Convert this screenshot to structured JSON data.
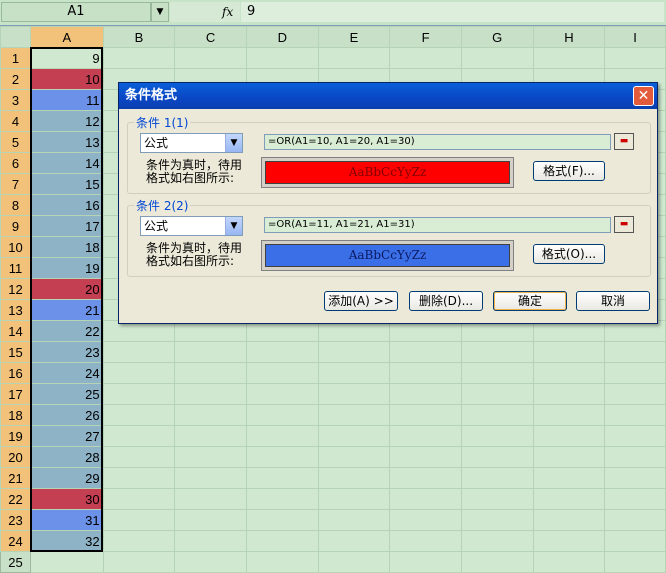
{
  "formula_bar": {
    "name_box": "A1",
    "fx_label": "fx",
    "formula": "9"
  },
  "columns": [
    "A",
    "B",
    "C",
    "D",
    "E",
    "F",
    "G",
    "H",
    "I"
  ],
  "rows": [
    {
      "num": "1",
      "value": "9",
      "style": "sel"
    },
    {
      "num": "2",
      "value": "10",
      "style": "red"
    },
    {
      "num": "3",
      "value": "11",
      "style": "blue"
    },
    {
      "num": "4",
      "value": "12",
      "style": ""
    },
    {
      "num": "5",
      "value": "13",
      "style": ""
    },
    {
      "num": "6",
      "value": "14",
      "style": ""
    },
    {
      "num": "7",
      "value": "15",
      "style": ""
    },
    {
      "num": "8",
      "value": "16",
      "style": ""
    },
    {
      "num": "9",
      "value": "17",
      "style": ""
    },
    {
      "num": "10",
      "value": "18",
      "style": ""
    },
    {
      "num": "11",
      "value": "19",
      "style": ""
    },
    {
      "num": "12",
      "value": "20",
      "style": "red"
    },
    {
      "num": "13",
      "value": "21",
      "style": "blue"
    },
    {
      "num": "14",
      "value": "22",
      "style": ""
    },
    {
      "num": "15",
      "value": "23",
      "style": ""
    },
    {
      "num": "16",
      "value": "24",
      "style": ""
    },
    {
      "num": "17",
      "value": "25",
      "style": ""
    },
    {
      "num": "18",
      "value": "26",
      "style": ""
    },
    {
      "num": "19",
      "value": "27",
      "style": ""
    },
    {
      "num": "20",
      "value": "28",
      "style": ""
    },
    {
      "num": "21",
      "value": "29",
      "style": ""
    },
    {
      "num": "22",
      "value": "30",
      "style": "red"
    },
    {
      "num": "23",
      "value": "31",
      "style": "blue"
    },
    {
      "num": "24",
      "value": "32",
      "style": ""
    },
    {
      "num": "25",
      "value": "",
      "style": "inactive"
    }
  ],
  "dialog": {
    "title": "条件格式",
    "close_glyph": "✕",
    "condition1": {
      "label": "条件 1(1)",
      "type": "公式",
      "formula": "=OR(A1=10, A1=20, A1=30)",
      "desc_line1": "条件为真时，待用",
      "desc_line2": "格式如右图所示:",
      "preview_text": "AaBbCcYyZz",
      "format_button": "格式(F)...",
      "preview_color": "#ff0000",
      "preview_text_color": "#800000"
    },
    "condition2": {
      "label": "条件 2(2)",
      "type": "公式",
      "formula": "=OR(A1=11, A1=21, A1=31)",
      "desc_line1": "条件为真时，待用",
      "desc_line2": "格式如右图所示:",
      "preview_text": "AaBbCcYyZz",
      "format_button": "格式(O)...",
      "preview_color": "#3b6fe8",
      "preview_text_color": "#0b1a60"
    },
    "buttons": {
      "add": "添加(A) >>",
      "delete": "删除(D)...",
      "ok": "确定",
      "cancel": "取消"
    }
  },
  "colors": {
    "sheet_bg": "#cfe8cf",
    "highlight_red": "#c43f52",
    "highlight_blue": "#6c91e8",
    "column_a_fill": "#8fb3c6"
  }
}
